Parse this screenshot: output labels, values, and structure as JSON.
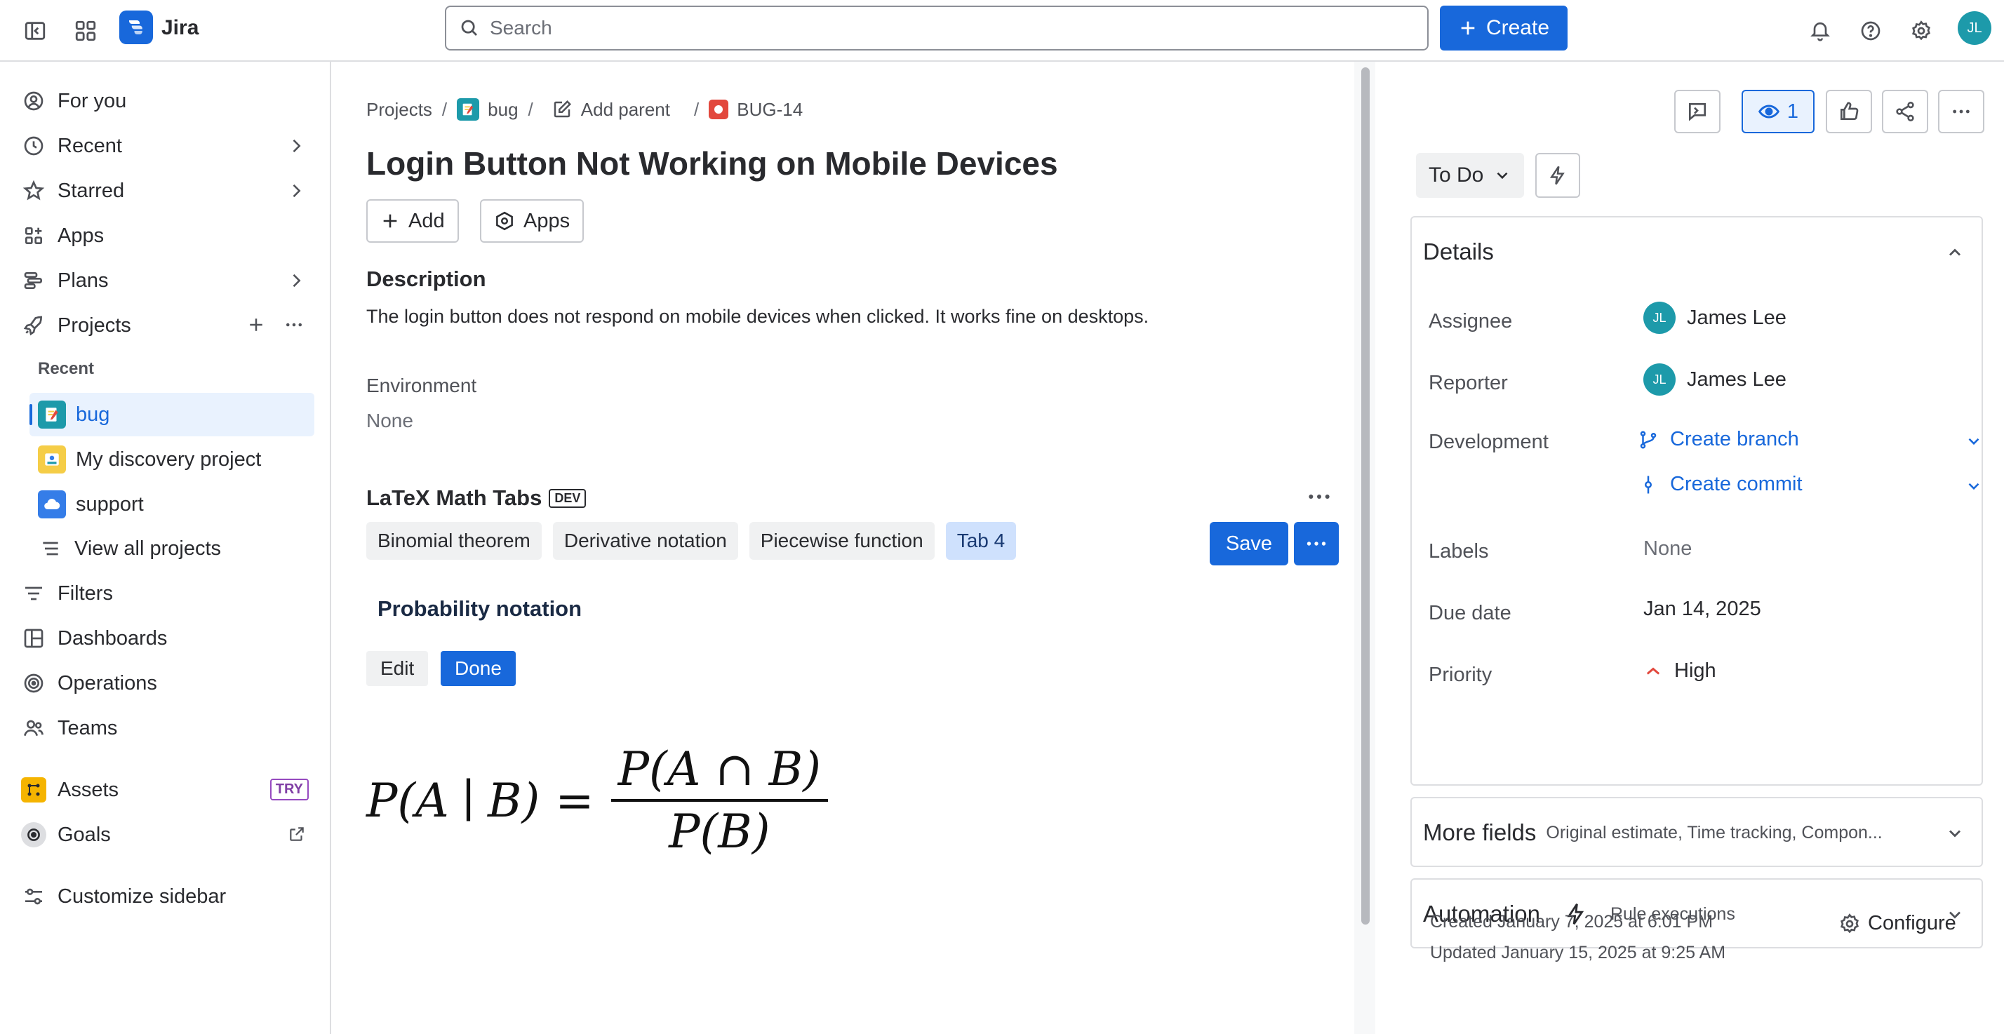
{
  "app": {
    "name": "Jira",
    "user_initials": "JL"
  },
  "search": {
    "placeholder": "Search"
  },
  "create_label": "Create",
  "sidebar": {
    "for_you": "For you",
    "recent": "Recent",
    "starred": "Starred",
    "apps": "Apps",
    "plans": "Plans",
    "projects": "Projects",
    "recent_header": "Recent",
    "project_items": [
      {
        "label": "bug",
        "active": true,
        "color": "#1d9aaa"
      },
      {
        "label": "My discovery project",
        "active": false,
        "color": "#f5cd47"
      },
      {
        "label": "support",
        "active": false,
        "color": "#357de8"
      }
    ],
    "view_all": "View all projects",
    "filters": "Filters",
    "dashboards": "Dashboards",
    "operations": "Operations",
    "teams": "Teams",
    "assets": "Assets",
    "assets_badge": "TRY",
    "goals": "Goals",
    "customize": "Customize sidebar"
  },
  "breadcrumb": {
    "projects": "Projects",
    "project": "bug",
    "add_parent": "Add parent",
    "issue_key": "BUG-14"
  },
  "issue": {
    "title": "Login Button Not Working on Mobile Devices",
    "add_label": "Add",
    "apps_label": "Apps",
    "description_heading": "Description",
    "description": "The login button does not respond on mobile devices when clicked. It works fine on desktops.",
    "environment_label": "Environment",
    "environment_value": "None"
  },
  "latex": {
    "heading": "LaTeX Math Tabs",
    "badge": "DEV",
    "tabs": [
      "Binomial theorem",
      "Derivative notation",
      "Piecewise function",
      "Tab 4"
    ],
    "selected_tab": 3,
    "save_label": "Save",
    "panel_title": "Probability notation",
    "edit_label": "Edit",
    "done_label": "Done",
    "formula": {
      "lhs_1": "P(A",
      "lhs_bar": "∣",
      "lhs_2": "B)",
      "equals": "=",
      "numerator": "P(A ∩ B)",
      "denominator": "P(B)"
    }
  },
  "right_panel": {
    "watchers_count": "1",
    "status": "To Do",
    "details_heading": "Details",
    "fields": {
      "assignee_label": "Assignee",
      "assignee_value": "James Lee",
      "assignee_initials": "JL",
      "reporter_label": "Reporter",
      "reporter_value": "James Lee",
      "reporter_initials": "JL",
      "development_label": "Development",
      "create_branch": "Create branch",
      "create_commit": "Create commit",
      "labels_label": "Labels",
      "labels_value": "None",
      "due_date_label": "Due date",
      "due_date_value": "Jan 14, 2025",
      "priority_label": "Priority",
      "priority_value": "High",
      "priority_color": "#e2483d"
    },
    "more_fields_title": "More fields",
    "more_fields_sub": "Original estimate, Time tracking, Compon...",
    "automation_title": "Automation",
    "automation_sub": "Rule executions",
    "created": "Created January 7, 2025 at 6:01 PM",
    "updated": "Updated January 15, 2025 at 9:25 AM",
    "configure": "Configure"
  }
}
